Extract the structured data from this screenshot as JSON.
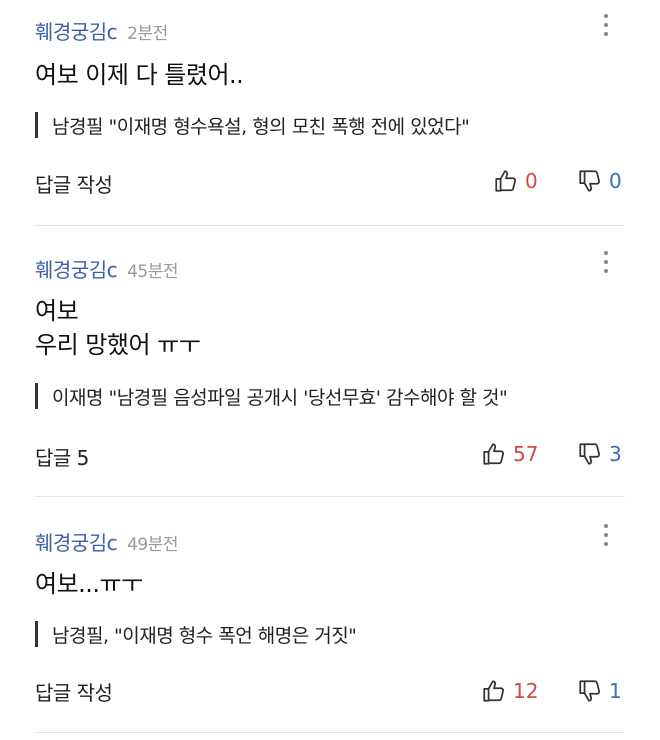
{
  "comments": [
    {
      "author": "훼경궁김c",
      "time": "2분전",
      "body": "여보 이제 다 틀렸어..",
      "quote": "남경필 \"이재명 형수욕설, 형의 모친 폭행 전에 있었다\"",
      "reply": "답글 작성",
      "likes": "0",
      "dislikes": "0"
    },
    {
      "author": "훼경궁김c",
      "time": "45분전",
      "body": "여보\n우리 망했어 ㅠㅜ",
      "quote": "이재명 \"남경필 음성파일 공개시 '당선무효' 감수해야 할 것\"",
      "reply": "답글 5",
      "likes": "57",
      "dislikes": "3"
    },
    {
      "author": "훼경궁김c",
      "time": "49분전",
      "body": "여보...ㅠㅜ",
      "quote": "남경필, \"이재명 형수 폭언 해명은 거짓\"",
      "reply": "답글 작성",
      "likes": "12",
      "dislikes": "1"
    }
  ],
  "icons": {
    "more": "more-vertical-icon",
    "like": "thumbs-up-icon",
    "dislike": "thumbs-down-icon"
  },
  "colors": {
    "author": "#3b5fa8",
    "like": "#d64545",
    "dislike": "#3b6fb8",
    "time": "#999999"
  }
}
